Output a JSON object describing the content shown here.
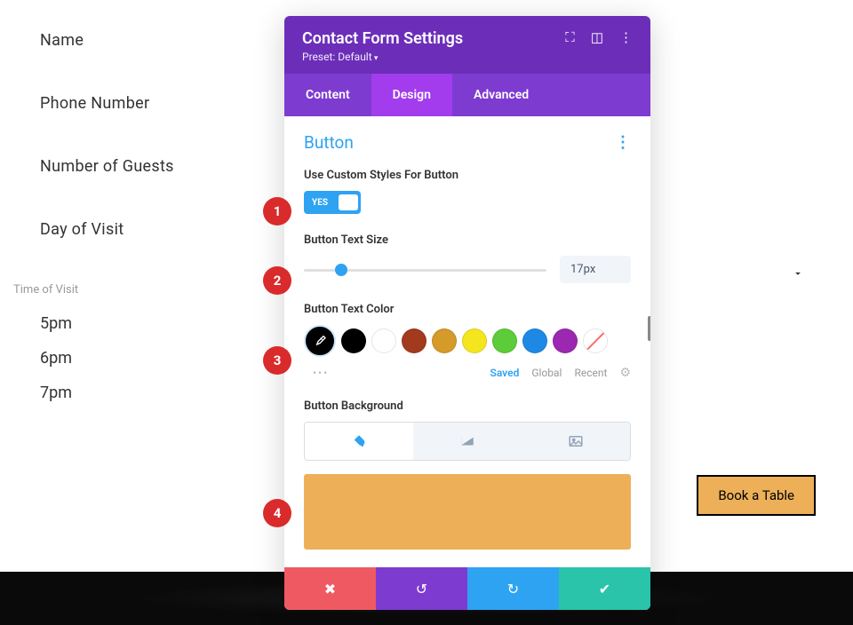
{
  "form": {
    "fields": [
      "Name",
      "Phone Number",
      "Number of Guests",
      "Day of Visit"
    ],
    "time_label": "Time of Visit",
    "times": [
      "5pm",
      "6pm",
      "7pm"
    ]
  },
  "button": {
    "label": "Book a Table"
  },
  "panel": {
    "title": "Contact Form Settings",
    "preset": "Preset: Default",
    "tabs": {
      "content": "Content",
      "design": "Design",
      "advanced": "Advanced"
    },
    "section": "Button",
    "custom_styles": {
      "label": "Use Custom Styles For Button",
      "value": "YES"
    },
    "text_size": {
      "label": "Button Text Size",
      "value": "17px"
    },
    "text_color": {
      "label": "Button Text Color",
      "swatches": [
        "#000000",
        "#000000",
        "#ffffff",
        "#a23a1e",
        "#d49a2a",
        "#f4e51f",
        "#5ccc3a",
        "#1e88e5",
        "#9c27b0"
      ],
      "subtabs": {
        "saved": "Saved",
        "global": "Global",
        "recent": "Recent"
      }
    },
    "bg": {
      "label": "Button Background",
      "preview_color": "#edb059"
    }
  },
  "markers": [
    "1",
    "2",
    "3",
    "4"
  ]
}
